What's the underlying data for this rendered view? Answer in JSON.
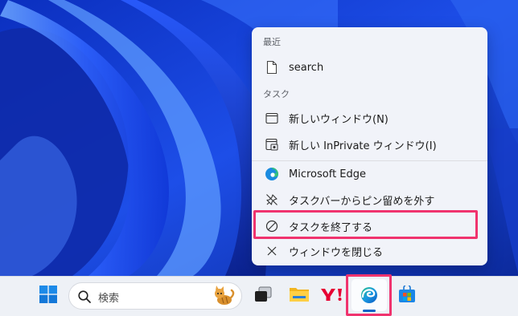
{
  "jumplist": {
    "recent_heading": "最近",
    "recent_items": [
      {
        "label": "search",
        "icon": "document-icon"
      }
    ],
    "tasks_heading": "タスク",
    "task_items": [
      {
        "label": "新しいウィンドウ(N)",
        "icon": "window-icon"
      },
      {
        "label": "新しい InPrivate ウィンドウ(I)",
        "icon": "inprivate-window-icon"
      }
    ],
    "app_items": [
      {
        "label": "Microsoft Edge",
        "icon": "edge-icon"
      },
      {
        "label": "タスクバーからピン留めを外す",
        "icon": "unpin-icon"
      },
      {
        "label": "タスクを終了する",
        "icon": "end-task-icon",
        "highlighted": true
      },
      {
        "label": "ウィンドウを閉じる",
        "icon": "close-icon"
      }
    ]
  },
  "taskbar": {
    "search_placeholder": "検索",
    "items": [
      "start-icon",
      "search-box",
      "task-view-icon",
      "file-explorer-icon",
      "yahoo-icon",
      "edge-icon",
      "store-icon"
    ],
    "active_item": "edge-icon"
  },
  "colors": {
    "highlight": "#f0336e",
    "edge_indicator": "#0a64c8",
    "menu_background": "#f1f3f9",
    "taskbar_background": "#eef1f6"
  }
}
